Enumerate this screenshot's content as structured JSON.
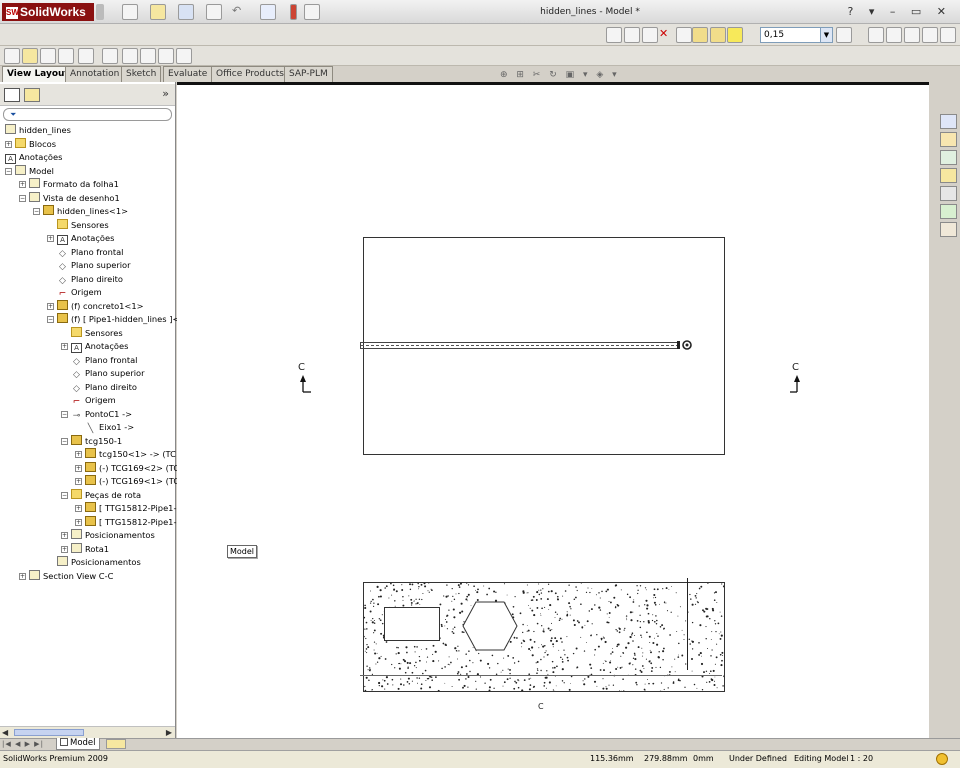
{
  "app": {
    "brand": "SolidWorks",
    "logo_badge": "SW",
    "doc_title": "hidden_lines - Model *"
  },
  "toolbar": {
    "scale_value": "0,15"
  },
  "tabs": [
    {
      "label": "View Layout",
      "active": true
    },
    {
      "label": "Annotation",
      "active": false
    },
    {
      "label": "Sketch",
      "active": false
    },
    {
      "label": "Evaluate",
      "active": false
    },
    {
      "label": "Office Products",
      "active": false
    },
    {
      "label": "SAP-PLM",
      "active": false
    }
  ],
  "tree": [
    {
      "label": "hidden_lines",
      "depth": 0,
      "exp": "",
      "icon": "drawing-icon"
    },
    {
      "label": "Blocos",
      "depth": 0,
      "exp": "+",
      "icon": "folder-icon"
    },
    {
      "label": "Anotações",
      "depth": 0,
      "exp": "",
      "icon": "annotation-icon"
    },
    {
      "label": "Model",
      "depth": 0,
      "exp": "-",
      "icon": "sheet-icon"
    },
    {
      "label": "Formato da folha1",
      "depth": 1,
      "exp": "+",
      "icon": "sheet-format-icon"
    },
    {
      "label": "Vista de desenho1",
      "depth": 1,
      "exp": "-",
      "icon": "drawing-view-icon"
    },
    {
      "label": "hidden_lines<1>",
      "depth": 2,
      "exp": "-",
      "icon": "assembly-icon"
    },
    {
      "label": "Sensores",
      "depth": 3,
      "exp": "",
      "icon": "sensor-icon"
    },
    {
      "label": "Anotações",
      "depth": 3,
      "exp": "+",
      "icon": "annotation-icon"
    },
    {
      "label": "Plano frontal",
      "depth": 3,
      "exp": "",
      "icon": "plane-icon"
    },
    {
      "label": "Plano superior",
      "depth": 3,
      "exp": "",
      "icon": "plane-icon"
    },
    {
      "label": "Plano direito",
      "depth": 3,
      "exp": "",
      "icon": "plane-icon"
    },
    {
      "label": "Origem",
      "depth": 3,
      "exp": "",
      "icon": "origin-icon"
    },
    {
      "label": "(f) concreto1<1>",
      "depth": 3,
      "exp": "+",
      "icon": "part-icon"
    },
    {
      "label": "(f) [ Pipe1-hidden_lines ]<1",
      "depth": 3,
      "exp": "-",
      "icon": "part-icon"
    },
    {
      "label": "Sensores",
      "depth": 4,
      "exp": "",
      "icon": "sensor-icon"
    },
    {
      "label": "Anotações",
      "depth": 4,
      "exp": "+",
      "icon": "annotation-icon"
    },
    {
      "label": "Plano frontal",
      "depth": 4,
      "exp": "",
      "icon": "plane-icon"
    },
    {
      "label": "Plano superior",
      "depth": 4,
      "exp": "",
      "icon": "plane-icon"
    },
    {
      "label": "Plano direito",
      "depth": 4,
      "exp": "",
      "icon": "plane-icon"
    },
    {
      "label": "Origem",
      "depth": 4,
      "exp": "",
      "icon": "origin-icon"
    },
    {
      "label": "PontoC1 ->",
      "depth": 4,
      "exp": "-",
      "icon": "point-icon"
    },
    {
      "label": "Eixo1 ->",
      "depth": 5,
      "exp": "",
      "icon": "axis-icon"
    },
    {
      "label": "tcg150-1",
      "depth": 4,
      "exp": "-",
      "icon": "route-icon"
    },
    {
      "label": "tcg150<1> -> (TC",
      "depth": 5,
      "exp": "+",
      "icon": "part-icon"
    },
    {
      "label": "(-) TCG169<2> (TC",
      "depth": 5,
      "exp": "+",
      "icon": "part-icon"
    },
    {
      "label": "(-) TCG169<1> (TC",
      "depth": 5,
      "exp": "+",
      "icon": "part-icon"
    },
    {
      "label": "Peças de rota",
      "depth": 4,
      "exp": "-",
      "icon": "folder-icon"
    },
    {
      "label": "[ TTG15812-Pipe1-l",
      "depth": 5,
      "exp": "+",
      "icon": "part-icon"
    },
    {
      "label": "[ TTG15812-Pipe1-l",
      "depth": 5,
      "exp": "+",
      "icon": "part-icon"
    },
    {
      "label": "Posicionamentos",
      "depth": 4,
      "exp": "+",
      "icon": "mates-icon"
    },
    {
      "label": "Rota1",
      "depth": 4,
      "exp": "+",
      "icon": "route-sketch-icon"
    },
    {
      "label": "Posicionamentos",
      "depth": 3,
      "exp": "",
      "icon": "mates-icon"
    },
    {
      "label": "Section View C-C",
      "depth": 1,
      "exp": "+",
      "icon": "section-view-icon"
    }
  ],
  "canvas": {
    "section_marker_left": "C",
    "section_marker_right": "C",
    "section_view_label": "C",
    "sheet_tab_tooltip": "Model"
  },
  "bottom_tab": {
    "label": "Model"
  },
  "status": {
    "product": "SolidWorks Premium 2009",
    "x": "115.36mm",
    "y": "279.88mm",
    "z": "0mm",
    "state": "Under Defined",
    "mode": "Editing Model",
    "scale": "1 : 20"
  }
}
